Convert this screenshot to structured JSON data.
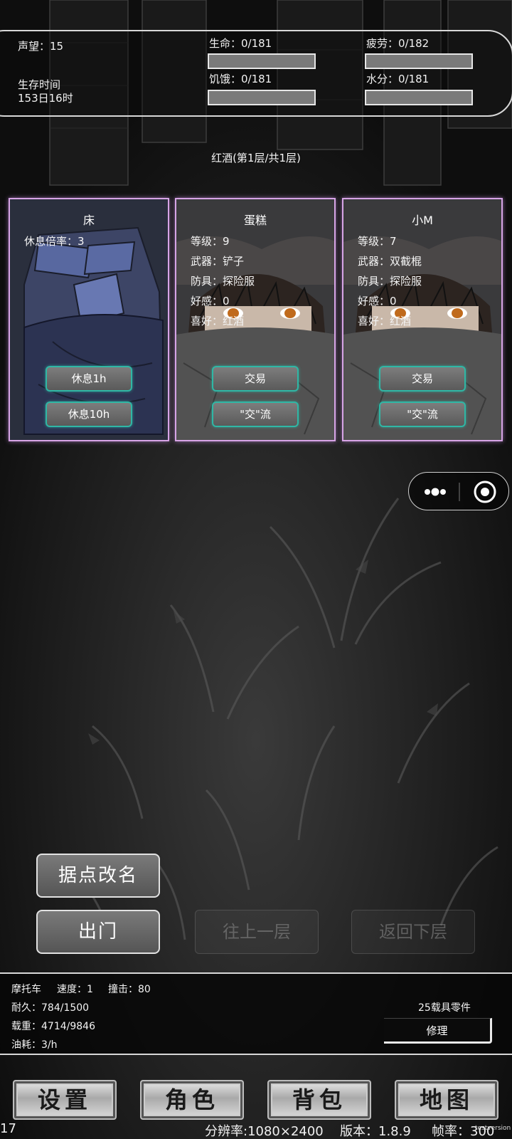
{
  "status": {
    "reputation": "声望：15",
    "survival_label": "生存时间",
    "survival_time": "153日16时",
    "life": "生命：0/181",
    "fatigue": "疲劳：0/182",
    "hunger": "饥饿：0/181",
    "water": "水分：0/181",
    "life_fill": 0,
    "fatigue_fill": 0,
    "hunger_fill": 0,
    "water_fill": 0
  },
  "location": {
    "title": "红酒(第1层/共1层)"
  },
  "cards": {
    "bed": {
      "title": "床",
      "rest_rate": "休息倍率：3",
      "btn1": "休息1h",
      "btn2": "休息10h"
    },
    "npc1": {
      "title": "蛋糕",
      "level": "等级：9",
      "weapon": "武器：铲子",
      "armor": "防具：探险服",
      "favor": "好感：0",
      "like": "喜好：红酒",
      "btn1": "交易",
      "btn2": "\"交\"流"
    },
    "npc2": {
      "title": "小M",
      "level": "等级：7",
      "weapon": "武器：双截棍",
      "armor": "防具：探险服",
      "favor": "好感：0",
      "like": "喜好：红酒",
      "btn1": "交易",
      "btn2": "\"交\"流"
    }
  },
  "capsule": {
    "icons": [
      "more-dots-icon",
      "close-target-icon"
    ]
  },
  "actions": {
    "rename": "据点改名",
    "go_out": "出门",
    "go_up": "往上一层",
    "go_down": "返回下层"
  },
  "vehicle": {
    "name": "摩托车",
    "speed": "速度：1",
    "impact": "撞击：80",
    "durability": "耐久：784/1500",
    "load": "载重：4714/9846",
    "fuel": "油耗：3/h",
    "parts": "25载具零件",
    "repair": "修理"
  },
  "nav": {
    "settings": "设置",
    "character": "角色",
    "backpack": "背包",
    "map": "地图"
  },
  "footer": {
    "left_num": "17",
    "resolution": "分辨率:1080×2400",
    "version": "版本：1.8.9",
    "fps": "帧率：300",
    "watermark": "testversion"
  },
  "colors": {
    "card_border": "#d7a4e6",
    "button_border": "#2fb7a5",
    "panel_border": "#d8d8d8"
  }
}
